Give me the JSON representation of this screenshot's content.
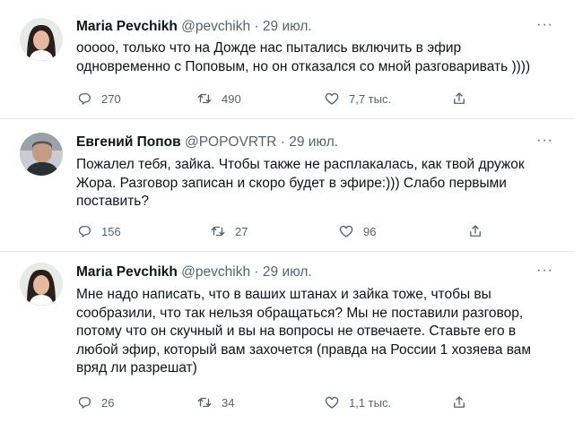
{
  "tweets": [
    {
      "name": "Maria Pevchikh",
      "handle": "@pevchikh",
      "separator": "·",
      "date": "29 июл.",
      "more": "···",
      "text": "ооооо, только что на Дожде нас пытались включить в эфир\nодновременно с Поповым, но он отказался со мной разговаривать ))))",
      "replies": "270",
      "retweets": "490",
      "likes": "7,7 тыс.",
      "avatar": "woman-portrait"
    },
    {
      "name": "Евгений Попов",
      "handle": "@POPOVRTR",
      "separator": "·",
      "date": "29 июл.",
      "more": "···",
      "text": "Пожалел тебя, зайка. Чтобы также не расплакалась, как твой дружок\nЖора. Разговор записан и скоро будет в эфире:))) Слабо первыми\nпоставить?",
      "replies": "156",
      "retweets": "27",
      "likes": "96",
      "avatar": "man-portrait"
    },
    {
      "name": "Maria Pevchikh",
      "handle": "@pevchikh",
      "separator": "·",
      "date": "29 июл.",
      "more": "···",
      "text": "Мне надо написать, что в ваших штанах и зайка тоже, чтобы вы\nсообразили, что так нельзя обращаться? Мы не поставили разговор,\nпотому что он скучный и вы на вопросы не отвечаете.  Ставьте его в\nлюбой эфир, который вам захочется (правда на России 1 хозяева вам\nвряд ли разрешат)",
      "replies": "26",
      "retweets": "34",
      "likes": "1,1 тыс.",
      "avatar": "woman-portrait"
    }
  ],
  "colors": {
    "text": "#0f1419",
    "secondary": "#536471",
    "divider": "#e4e8eb",
    "background": "#ffffff"
  },
  "icons": [
    "reply-icon",
    "retweet-icon",
    "like-icon",
    "share-icon",
    "more-icon"
  ]
}
